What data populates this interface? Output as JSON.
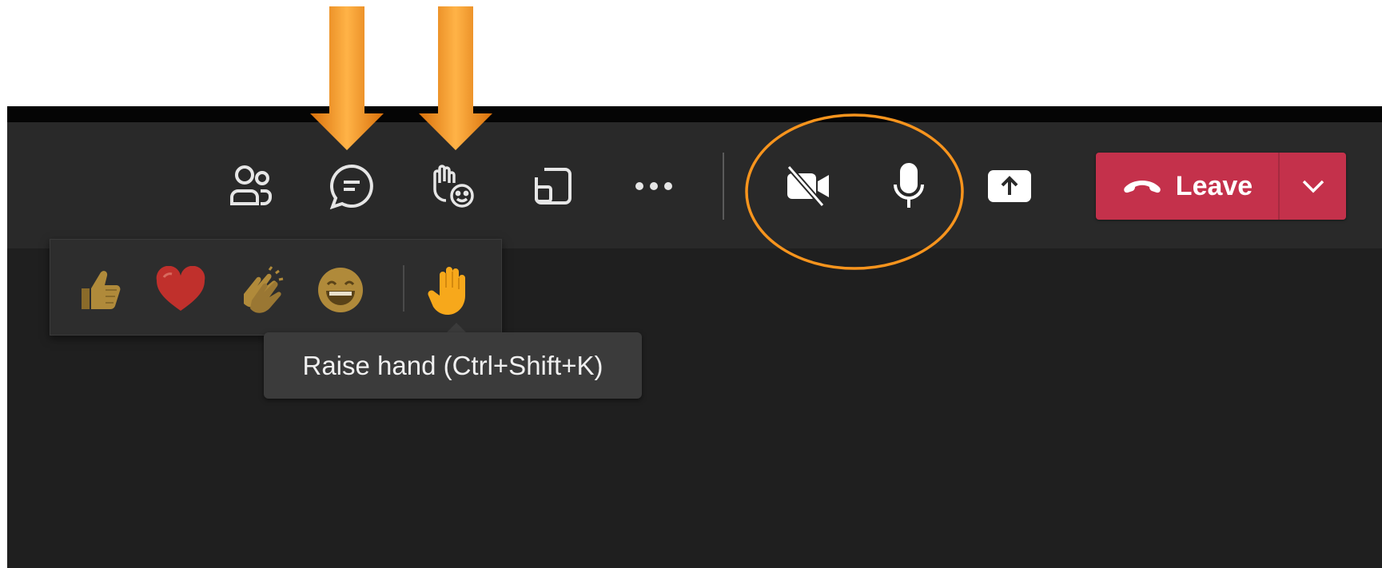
{
  "toolbar": {
    "buttons": [
      {
        "icon": "people-icon",
        "name": "participants-button"
      },
      {
        "icon": "chat-icon",
        "name": "chat-button"
      },
      {
        "icon": "raise-hand-react-icon",
        "name": "reactions-button"
      },
      {
        "icon": "rooms-icon",
        "name": "rooms-button"
      },
      {
        "icon": "more-options-icon",
        "name": "more-options-button"
      },
      {
        "icon": "camera-off-icon",
        "name": "camera-toggle-button"
      },
      {
        "icon": "microphone-icon",
        "name": "microphone-toggle-button"
      },
      {
        "icon": "share-icon",
        "name": "share-button"
      }
    ],
    "leave": {
      "label": "Leave",
      "icon": "phone-hangup-icon",
      "dropdown_icon": "chevron-down-icon"
    }
  },
  "reactions": {
    "items": [
      {
        "icon": "thumbs-up-icon",
        "name": "like-reaction"
      },
      {
        "icon": "heart-icon",
        "name": "love-reaction"
      },
      {
        "icon": "clapping-hands-icon",
        "name": "applause-reaction"
      },
      {
        "icon": "laughing-face-icon",
        "name": "laugh-reaction"
      },
      {
        "icon": "raised-hand-icon",
        "name": "raise-hand-reaction"
      }
    ],
    "tooltip": "Raise hand (Ctrl+Shift+K)"
  },
  "colors": {
    "toolbar_bg": "#292929",
    "stage_bg": "#1f1f1f",
    "leave_red": "#c4314b",
    "annotation_orange": "#f7941d",
    "emoji_gold": "#b08a3a",
    "heart_red": "#c0302c"
  },
  "annotations": {
    "arrows": [
      "chat-button",
      "reactions-button"
    ],
    "highlight_circle": [
      "camera-toggle-button",
      "microphone-toggle-button"
    ]
  }
}
